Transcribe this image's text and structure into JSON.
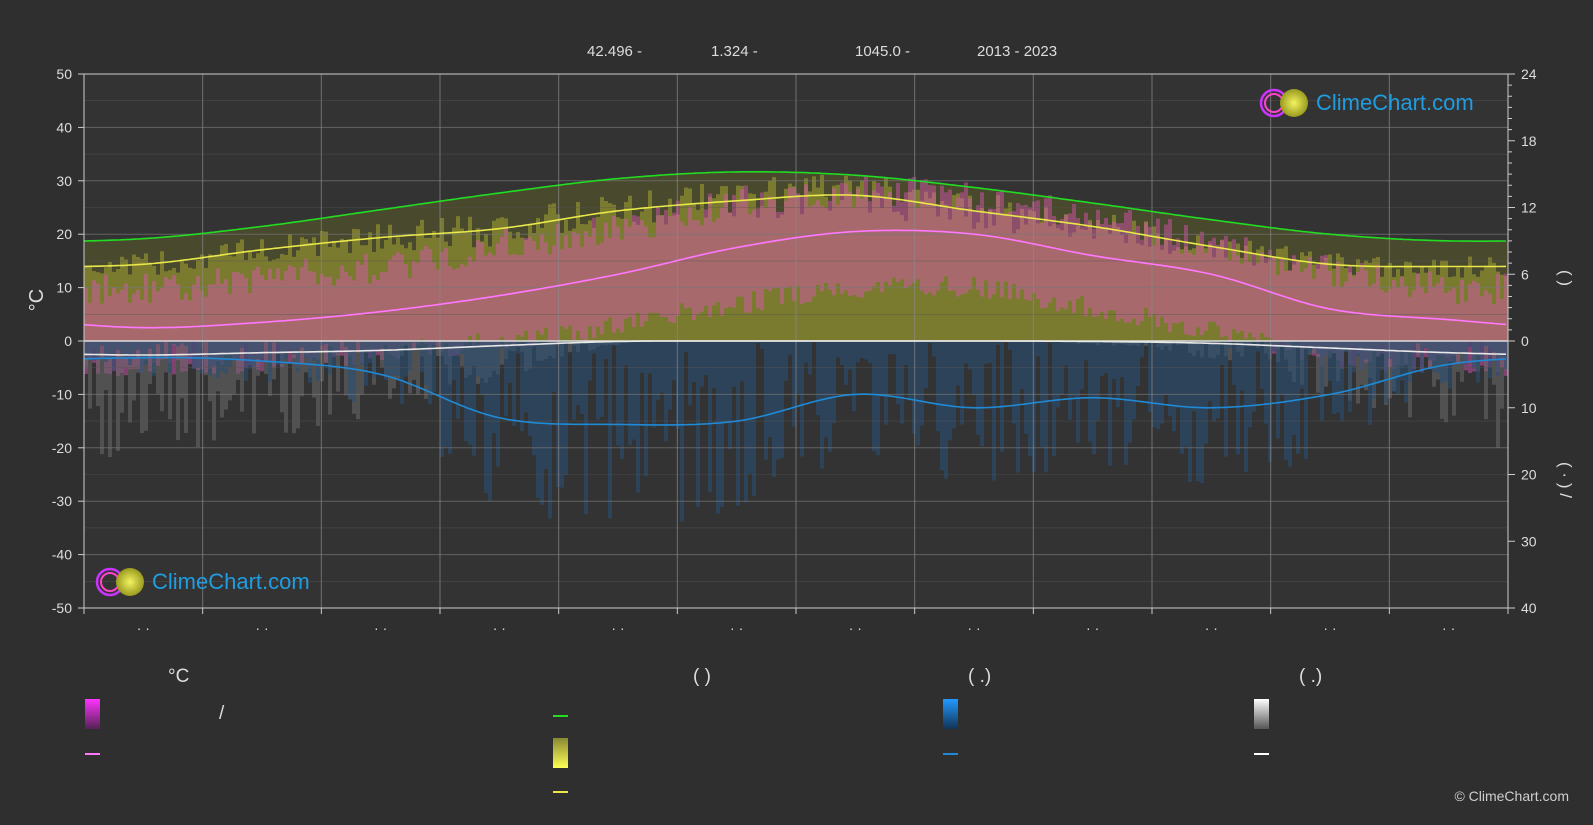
{
  "header": {
    "lat": "42.496 -",
    "lon": "1.324 -",
    "elev": "1045.0 -",
    "years": "2013 - 2023"
  },
  "brand": {
    "logo_text": "ClimeChart.com",
    "copyright": "© ClimeChart.com"
  },
  "colors": {
    "background": "#2f2f2f",
    "daylight": "#22dd22",
    "sunshine": "#e8e84a",
    "temp_max_line": "#ff77ff",
    "temp_band": "#e055b8",
    "rain": "#1f8ad6",
    "snow": "#e8e8e8",
    "brand_blue": "#1f9de0"
  },
  "chart_data": {
    "type": "line",
    "x_months": 12,
    "grid": true,
    "left_axis": {
      "label": "°C",
      "min": -50,
      "max": 50,
      "ticks": [
        50,
        40,
        30,
        20,
        10,
        0,
        -10,
        -20,
        -30,
        -40,
        -50
      ]
    },
    "right_axis_upper": {
      "label": "( )",
      "min": 0,
      "max": 24,
      "ticks": [
        24,
        18,
        12,
        6,
        0
      ]
    },
    "right_axis_lower": {
      "label": "( · ) /",
      "min": 0,
      "max": 40,
      "ticks": [
        10,
        20,
        30,
        40
      ]
    },
    "month_labels": [
      "· ·",
      "· ·",
      "· ·",
      "· ·",
      "· ·",
      "· ·",
      "· ·",
      "· ·",
      "· ·",
      "· ·",
      "· ·",
      "· ·"
    ],
    "series": [
      {
        "key": "daylight_hours",
        "values": [
          9.2,
          10.3,
          11.8,
          13.3,
          14.6,
          15.2,
          14.9,
          13.8,
          12.4,
          10.9,
          9.6,
          9.0
        ]
      },
      {
        "key": "sunshine_hours",
        "values": [
          6.9,
          8.2,
          9.3,
          10.1,
          11.7,
          12.6,
          13.1,
          11.7,
          10.3,
          8.5,
          6.9,
          6.7
        ]
      },
      {
        "key": "temp_mean_c",
        "values": [
          2.5,
          3.5,
          5.5,
          8.5,
          12.5,
          17.5,
          20.5,
          20.0,
          16.0,
          12.5,
          6.0,
          4.0
        ]
      },
      {
        "key": "rain_mm",
        "values": [
          2.5,
          3.0,
          5.0,
          11.5,
          12.5,
          12.0,
          8.0,
          10.0,
          8.5,
          10.0,
          8.0,
          3.5
        ]
      },
      {
        "key": "snow_mm",
        "values": [
          3.0,
          2.5,
          2.0,
          1.0,
          0.1,
          0.0,
          0.0,
          0.0,
          0.1,
          0.5,
          1.5,
          2.5
        ]
      },
      {
        "key": "temp_band_max_c",
        "values": [
          10,
          12,
          14,
          18,
          21,
          26,
          28,
          27,
          23,
          18,
          13,
          10
        ]
      },
      {
        "key": "temp_band_min_c",
        "values": [
          -5,
          -4,
          -2,
          0,
          3,
          7,
          10,
          10,
          6,
          2,
          -3,
          -4
        ]
      }
    ]
  },
  "legend": {
    "col1_head": "°C",
    "col1_slash": "/",
    "col2_head": "(          )",
    "col3_head": "(   .)",
    "col4_head": "(   .)"
  }
}
